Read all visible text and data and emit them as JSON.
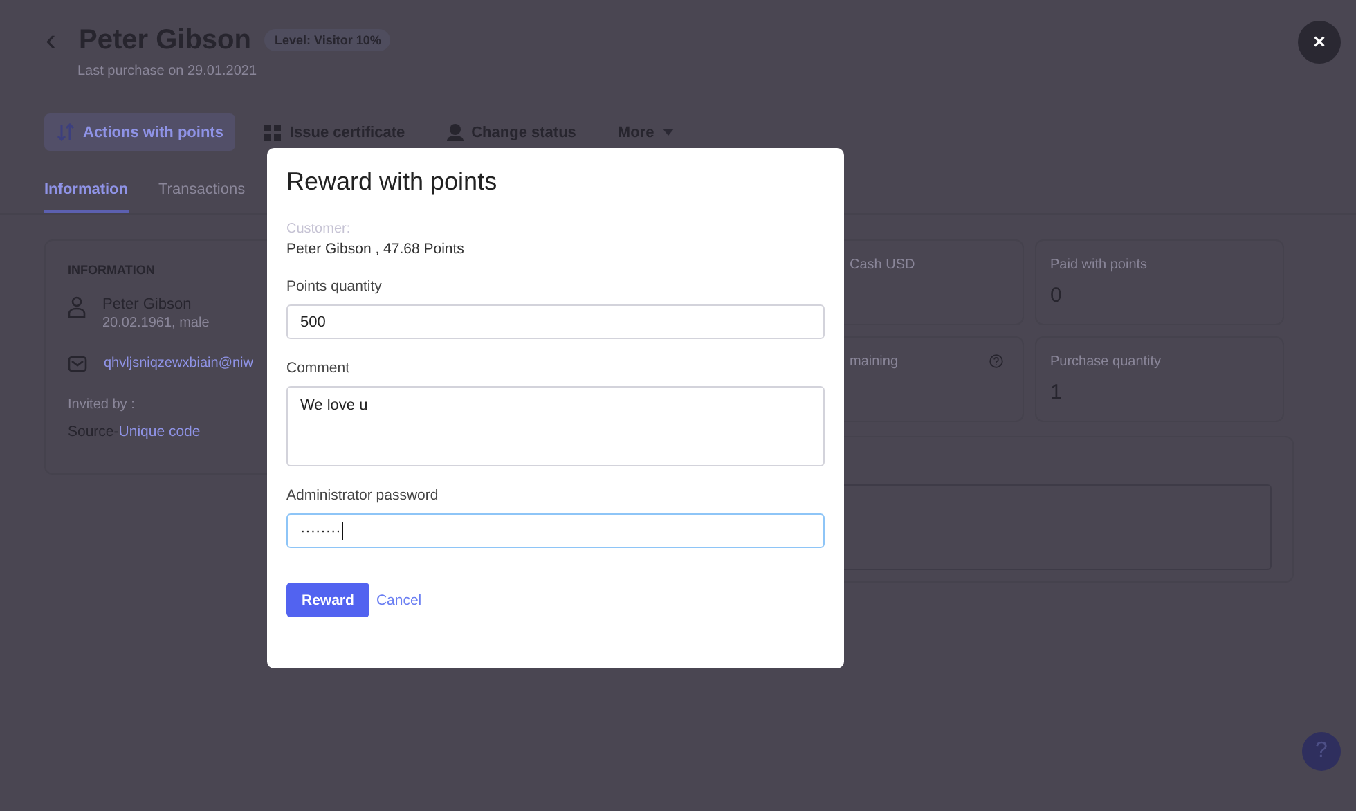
{
  "header": {
    "back": "‹",
    "title": "Peter Gibson",
    "level_badge": "Level: Visitor 10%",
    "subtitle": "Last purchase on 29.01.2021"
  },
  "close_button": "×",
  "actions": [
    {
      "label": "Actions with points",
      "selected": true
    },
    {
      "label": "Issue certificate",
      "selected": false
    },
    {
      "label": "Change status",
      "selected": false
    },
    {
      "label": "More",
      "selected": false
    }
  ],
  "tabs": [
    {
      "label": "Information",
      "selected": true
    },
    {
      "label": "Transactions",
      "selected": false
    }
  ],
  "info_card": {
    "heading": "INFORMATION",
    "name": "Peter Gibson",
    "details": "20.02.1961, male",
    "email": "qhvljsniqzewxbiain@niw",
    "invited_by": "Invited by :",
    "source_label": "Source-",
    "source_link": "Unique code"
  },
  "stats": [
    {
      "label": "Cash USD",
      "help": false
    },
    {
      "label": "Paid with points",
      "value": "0",
      "help": false
    },
    {
      "label": "maining",
      "help": true
    },
    {
      "label": "Purchase quantity",
      "value": "1",
      "help": false
    }
  ],
  "help_button": "?",
  "modal": {
    "title": "Reward with points",
    "customer_label": "Customer:",
    "customer_value": "Peter Gibson , 47.68 Points",
    "fields": [
      {
        "label": "Points quantity",
        "kind": "input",
        "value": "500",
        "focused": false
      },
      {
        "label": "Comment",
        "kind": "textarea",
        "value": "We love u",
        "focused": false
      },
      {
        "label": "Administrator password",
        "kind": "password",
        "value": "········",
        "focused": true
      }
    ],
    "submit": "Reward",
    "cancel": "Cancel"
  }
}
